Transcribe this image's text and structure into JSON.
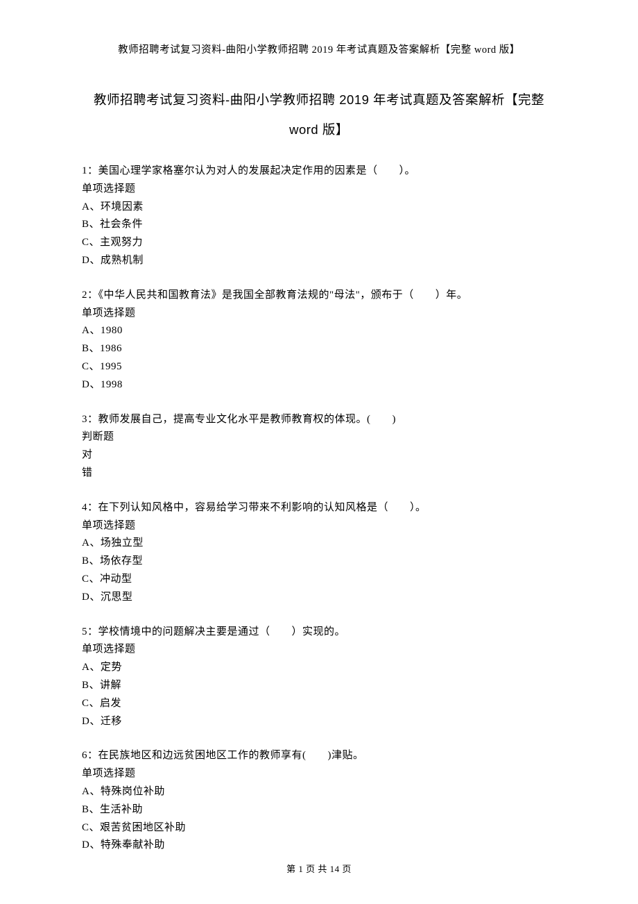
{
  "header": "教师招聘考试复习资料-曲阳小学教师招聘 2019 年考试真题及答案解析【完整 word 版】",
  "title_part1": "教师招聘考试复习资料-曲阳小学教师招聘 2019 年考试真题及答案解析【完整",
  "title_part2": "word 版】",
  "questions": [
    {
      "prompt": "1：美国心理学家格塞尔认为对人的发展起决定作用的因素是（　　）。",
      "type": "单项选择题",
      "options": [
        "A、环境因素",
        "B、社会条件",
        "C、主观努力",
        "D、成熟机制"
      ]
    },
    {
      "prompt": "2：《中华人民共和国教育法》是我国全部教育法规的\"母法\"，颁布于（　　）年。",
      "type": "单项选择题",
      "options": [
        "A、1980",
        "B、1986",
        "C、1995",
        "D、1998"
      ]
    },
    {
      "prompt": "3：教师发展自己，提高专业文化水平是教师教育权的体现。(　　)",
      "type": "判断题",
      "options": [
        "对",
        "错"
      ]
    },
    {
      "prompt": "4：在下列认知风格中，容易给学习带来不利影响的认知风格是（　　）。",
      "type": "单项选择题",
      "options": [
        "A、场独立型",
        "B、场依存型",
        "C、冲动型",
        "D、沉思型"
      ]
    },
    {
      "prompt": "5：学校情境中的问题解决主要是通过（　　）实现的。",
      "type": "单项选择题",
      "options": [
        "A、定势",
        "B、讲解",
        "C、启发",
        "D、迁移"
      ]
    },
    {
      "prompt": "6：在民族地区和边远贫困地区工作的教师享有(　　)津贴。",
      "type": "单项选择题",
      "options": [
        "A、特殊岗位补助",
        "B、生活补助",
        "C、艰苦贫困地区补助",
        "D、特殊奉献补助"
      ]
    }
  ],
  "footer": "第 1 页 共 14 页"
}
